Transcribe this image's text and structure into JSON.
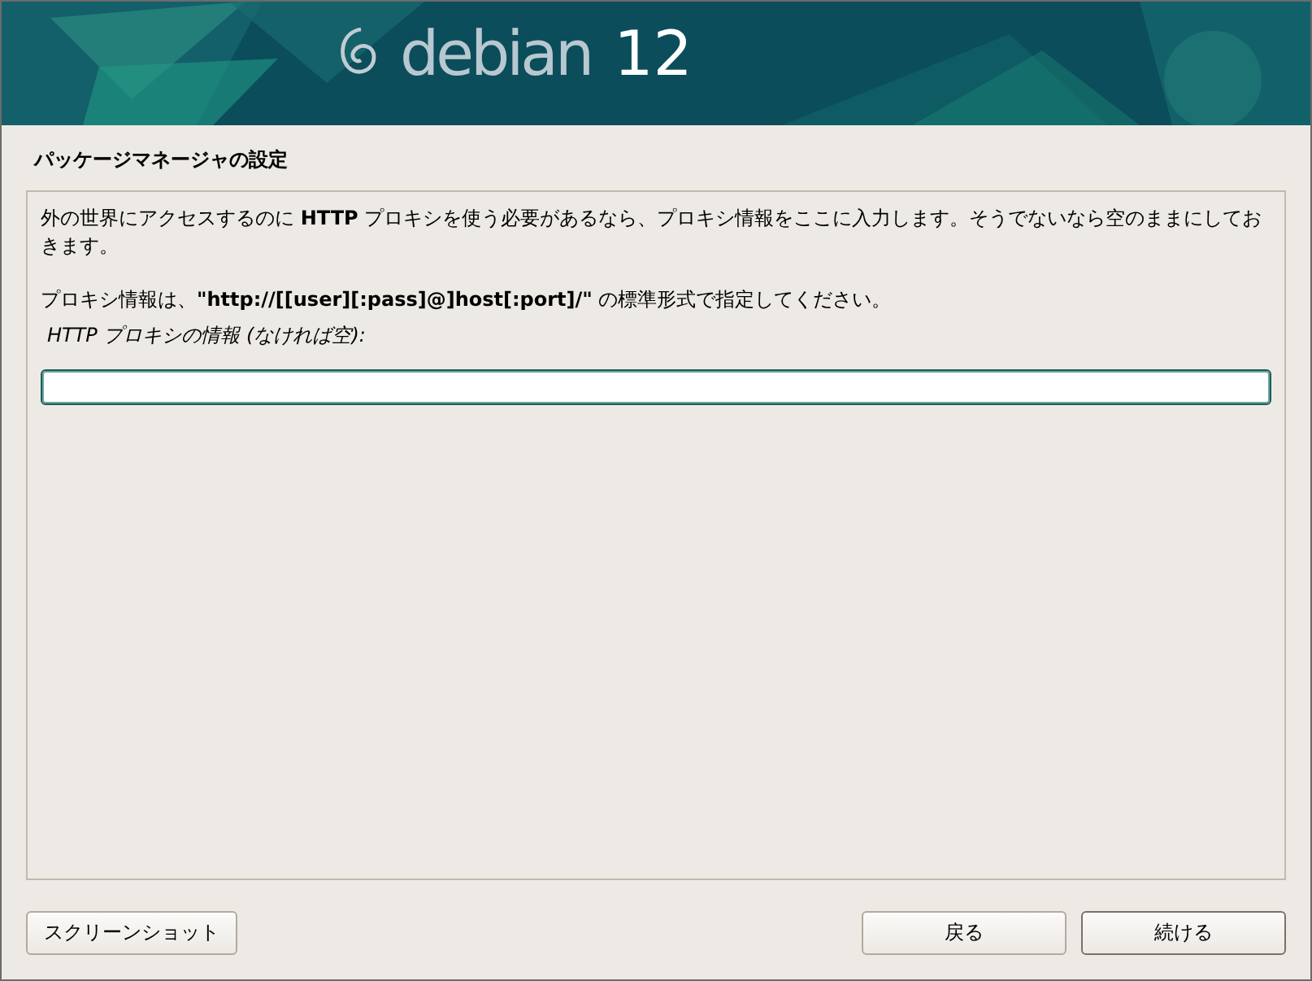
{
  "banner": {
    "logo": "debian",
    "version": "12"
  },
  "title": "パッケージマネージャの設定",
  "paragraphs": [
    "外の世界にアクセスするのに **HTTP** プロキシを使う必要があるなら、プロキシ情報をここに入力します。そうでないなら空のままにしておきます。",
    "プロキシ情報は、**\"http://[[user][:pass]@]host[:port]/\"** の標準形式で指定してください。"
  ],
  "field": {
    "label": "HTTP プロキシの情報 (なければ空):",
    "focused": true
  },
  "left_buttons": [
    {
      "label": "スクリーンショット",
      "default": false
    }
  ],
  "right_buttons": [
    {
      "label": "戻る",
      "default": false
    },
    {
      "label": "続ける",
      "default": true
    }
  ]
}
